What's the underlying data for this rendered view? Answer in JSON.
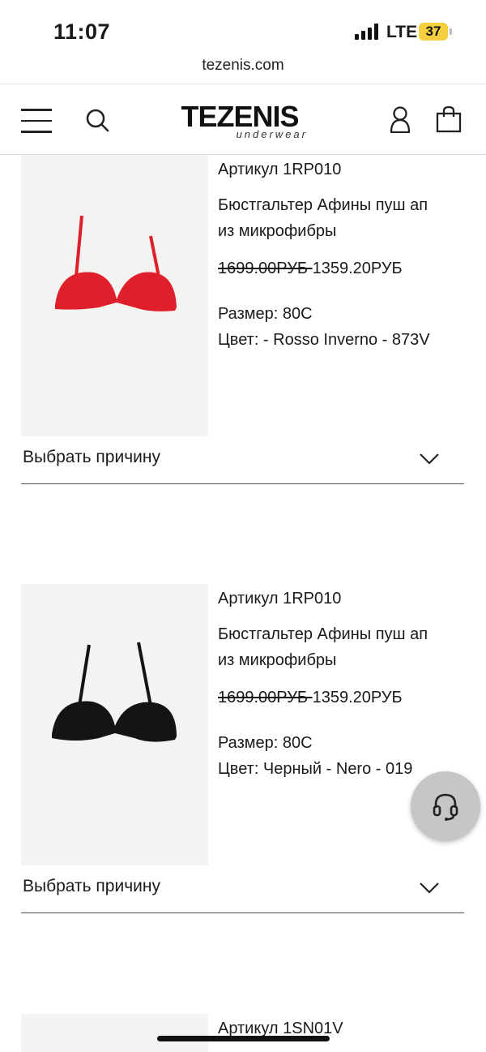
{
  "status_bar": {
    "time": "11:07",
    "network": "LTE",
    "battery": "37"
  },
  "browser": {
    "url": "tezenis.com"
  },
  "header": {
    "logo_main": "TEZENIS",
    "logo_sub": "underwear"
  },
  "products": [
    {
      "article": "Артикул 1RP010",
      "name_line1": "Бюстгальтер Афины пуш ап",
      "name_line2": "из микрофибры",
      "old_price": "1699.00РУБ ",
      "new_price": "1359.20РУБ",
      "size": "Размер: 80C",
      "color": "Цвет: - Rosso Inverno - 873V",
      "reason_label": "Выбрать причину",
      "swatch_color": "#e01f2d"
    },
    {
      "article": "Артикул 1RP010",
      "name_line1": "Бюстгальтер Афины пуш ап",
      "name_line2": "из микрофибры",
      "old_price": "1699.00РУБ ",
      "new_price": "1359.20РУБ",
      "size": "Размер: 80C",
      "color": "Цвет: Черный - Nero - 019",
      "reason_label": "Выбрать причину",
      "swatch_color": "#141414"
    },
    {
      "article": "Артикул 1SN01V"
    }
  ],
  "colors": {
    "accent_yellow": "#f4d03f",
    "support_bg": "#c8c6c4"
  }
}
